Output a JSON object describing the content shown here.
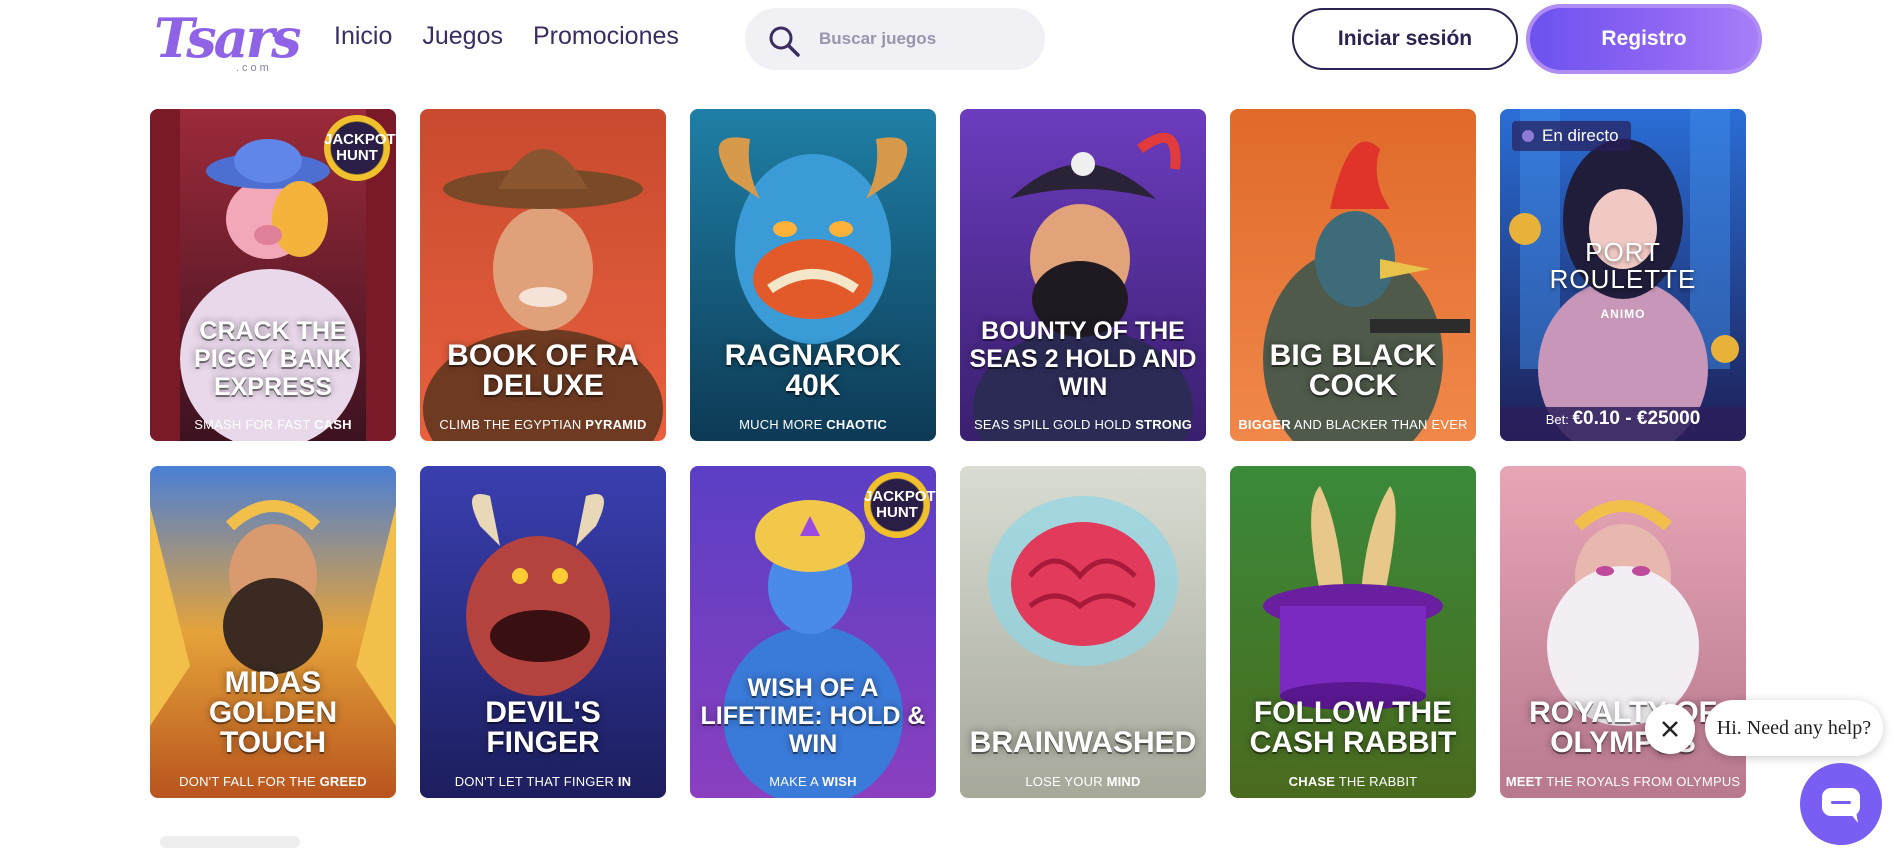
{
  "brand": {
    "logo_text": "Tsars",
    "logo_sub": ".com"
  },
  "nav": {
    "items": [
      "Inicio",
      "Juegos",
      "Promociones"
    ]
  },
  "search": {
    "placeholder": "Buscar juegos"
  },
  "auth": {
    "login_label": "Iniciar sesión",
    "register_label": "Registro"
  },
  "games": [
    {
      "title": "Crack the Piggy Bank Express",
      "tag_pre": "SMASH FOR FAST ",
      "tag_bold": "CASH",
      "tag_post": "",
      "badge": "JACKPOT HUNT"
    },
    {
      "title": "Book of Ra Deluxe",
      "tag_pre": "CLIMB THE EGYPTIAN ",
      "tag_bold": "PYRAMID",
      "tag_post": ""
    },
    {
      "title": "Ragnarok 40K",
      "tag_pre": "MUCH MORE ",
      "tag_bold": "CHAOTIC",
      "tag_post": ""
    },
    {
      "title": "Bounty of the Seas 2 Hold and Win",
      "tag_pre": "SEAS SPILL GOLD HOLD ",
      "tag_bold": "STRONG",
      "tag_post": ""
    },
    {
      "title": "Big Black Cock",
      "tag_pre": "",
      "tag_bold": "BIGGER",
      "tag_post": " AND BLACKER THAN EVER"
    },
    {
      "title": "PORT ROULETTE",
      "subtitle": "ANIMO",
      "live_label": "En directo",
      "bet_label": "Bet: ",
      "bet_range": "€0.10 - €25000"
    },
    {
      "title": "Midas Golden Touch",
      "tag_pre": "DON'T FALL FOR THE ",
      "tag_bold": "GREED",
      "tag_post": ""
    },
    {
      "title": "Devil's Finger",
      "tag_pre": "DON'T LET THAT FINGER ",
      "tag_bold": "IN",
      "tag_post": ""
    },
    {
      "title": "Wish of a Lifetime: Hold & Win",
      "tag_pre": "MAKE A ",
      "tag_bold": "WISH",
      "tag_post": "",
      "badge": "JACKPOT HUNT"
    },
    {
      "title": "Brainwashed",
      "tag_pre": "LOSE YOUR ",
      "tag_bold": "MIND",
      "tag_post": ""
    },
    {
      "title": "Follow the Cash Rabbit",
      "tag_pre": "",
      "tag_bold": "CHASE",
      "tag_post": " THE RABBIT"
    },
    {
      "title": "Royalty of Olympus",
      "tag_pre": "",
      "tag_bold": "MEET",
      "tag_post": " THE ROYALS FROM OLYMPUS"
    }
  ],
  "chat": {
    "greeting": "Hi. Need any help?"
  },
  "colors": {
    "accent": "#7a5df2",
    "text": "#3b2d62"
  }
}
